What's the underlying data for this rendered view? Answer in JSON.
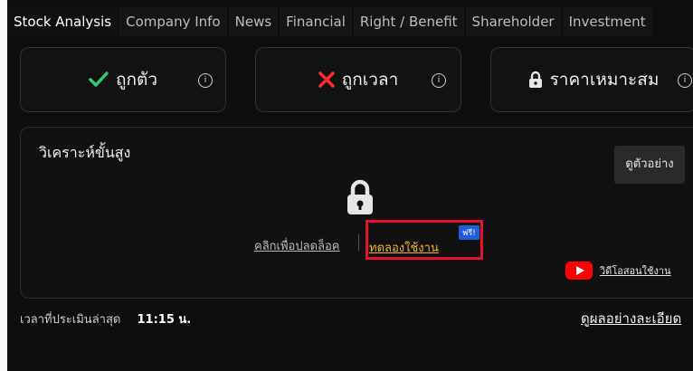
{
  "tabs": [
    {
      "label": "Stock Analysis",
      "active": true
    },
    {
      "label": "Company Info"
    },
    {
      "label": "News"
    },
    {
      "label": "Financial"
    },
    {
      "label": "Right / Benefit"
    },
    {
      "label": "Shareholder"
    },
    {
      "label": "Investment"
    }
  ],
  "cards": {
    "right_stock": {
      "label": "ถูกตัว",
      "icon": "checkmark-icon",
      "color": "#2ecc71"
    },
    "right_time": {
      "label": "ถูกเวลา",
      "icon": "x-icon",
      "color": "#ff2b2b"
    },
    "right_price": {
      "label": "ราคาเหมาะสม",
      "icon": "lock-icon"
    }
  },
  "advanced": {
    "title": "วิเคราะห์ขั้นสูง",
    "example_button": "ดูตัวอย่าง",
    "unlock_link": "คลิกเพื่อปลดล็อค",
    "try_link": "ทดลองใช้งาน",
    "free_badge": "ฟรี!",
    "video_link": "วิดีโอสอนใช้งาน"
  },
  "footer": {
    "time_label": "เวลาที่ประเมินล่าสุด",
    "time_value": "11:15 น.",
    "detail_link": "ดูผลอย่างละเอียด"
  },
  "colors": {
    "accent_gold": "#f0b428",
    "highlight_red": "#e8112d",
    "youtube_red": "#ff0000",
    "badge_blue": "#1f5ed8"
  }
}
